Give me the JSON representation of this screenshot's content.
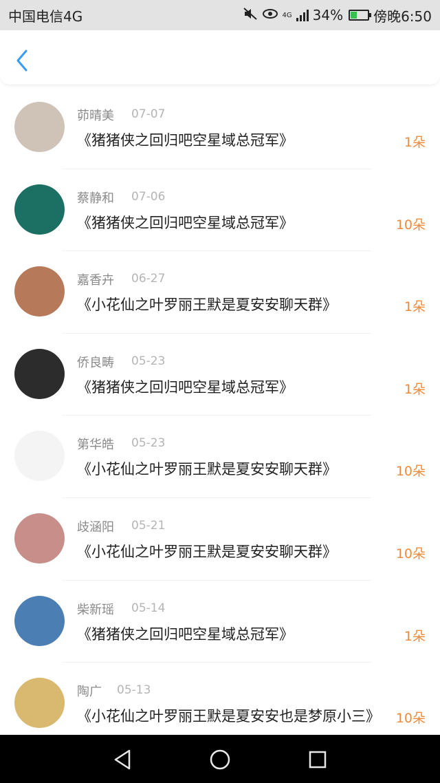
{
  "status_bar": {
    "carrier": "中国电信4G",
    "network": "4G",
    "battery": "34%",
    "time": "傍晚6:50"
  },
  "nav": {
    "back_icon": "chevron-left-icon"
  },
  "items": [
    {
      "name": "茆晴美",
      "date": "07-07",
      "title": "《猪猪侠之回归吧空星域总冠军》",
      "amount": "1朵",
      "avatar": "#cfc3b8"
    },
    {
      "name": "蔡静和",
      "date": "07-06",
      "title": "《猪猪侠之回归吧空星域总冠军》",
      "amount": "10朵",
      "avatar": "#1c6f63"
    },
    {
      "name": "嘉香卉",
      "date": "06-27",
      "title": "《小花仙之叶罗丽王默是夏安安聊天群》",
      "amount": "1朵",
      "avatar": "#b67a5a"
    },
    {
      "name": "侨良畴",
      "date": "05-23",
      "title": "《猪猪侠之回归吧空星域总冠军》",
      "amount": "1朵",
      "avatar": "#2c2c2c"
    },
    {
      "name": "第华皓",
      "date": "05-23",
      "title": "《小花仙之叶罗丽王默是夏安安聊天群》",
      "amount": "10朵",
      "avatar": "#f4f4f4"
    },
    {
      "name": "歧涵阳",
      "date": "05-21",
      "title": "《小花仙之叶罗丽王默是夏安安聊天群》",
      "amount": "10朵",
      "avatar": "#c88f8a"
    },
    {
      "name": "柴新瑶",
      "date": "05-14",
      "title": "《猪猪侠之回归吧空星域总冠军》",
      "amount": "1朵",
      "avatar": "#4b7fb4"
    },
    {
      "name": "陶广",
      "date": "05-13",
      "title": "《小花仙之叶罗丽王默是夏安安也是梦原小三》",
      "amount": "10朵",
      "avatar": "#d9b96f"
    }
  ],
  "colors": {
    "accent": "#3a9cf0",
    "amount": "#f08a3c"
  }
}
